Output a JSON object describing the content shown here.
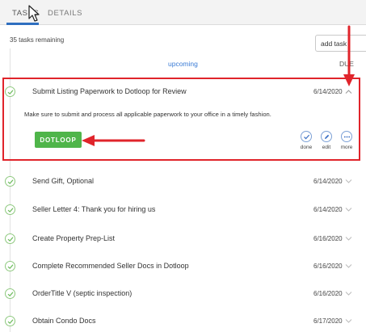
{
  "tabs": [
    {
      "label": "TASKS"
    },
    {
      "label": "DETAILS"
    }
  ],
  "tasks_remaining": "35 tasks remaining",
  "add_task_label": "add task",
  "section_label": "upcoming",
  "due_header": "DUE",
  "expanded_task": {
    "title": "Submit Listing Paperwork to Dotloop for Review",
    "date": "6/14/2020",
    "description": "Make sure to submit and process all applicable paperwork to your office in a timely fashion.",
    "button_label": "DOTLOOP",
    "actions": [
      {
        "label": "done",
        "icon": "check-icon"
      },
      {
        "label": "edit",
        "icon": "pencil-icon"
      },
      {
        "label": "more",
        "icon": "ellipsis-icon"
      }
    ]
  },
  "tasks": [
    {
      "title": "Send Gift, Optional",
      "date": "6/14/2020"
    },
    {
      "title": "Seller Letter 4: Thank you for hiring us",
      "date": "6/14/2020"
    },
    {
      "title": "Create Property Prep-List",
      "date": "6/16/2020"
    },
    {
      "title": "Complete Recommended Seller Docs in Dotloop",
      "date": "6/16/2020"
    },
    {
      "title": "OrderTitle V (septic inspection)",
      "date": "6/16/2020"
    },
    {
      "title": "Obtain Condo Docs",
      "date": "6/17/2020"
    }
  ],
  "colors": {
    "accent": "#3a7bd5",
    "done_green": "#4fb54a",
    "highlight_red": "#e0242b"
  }
}
